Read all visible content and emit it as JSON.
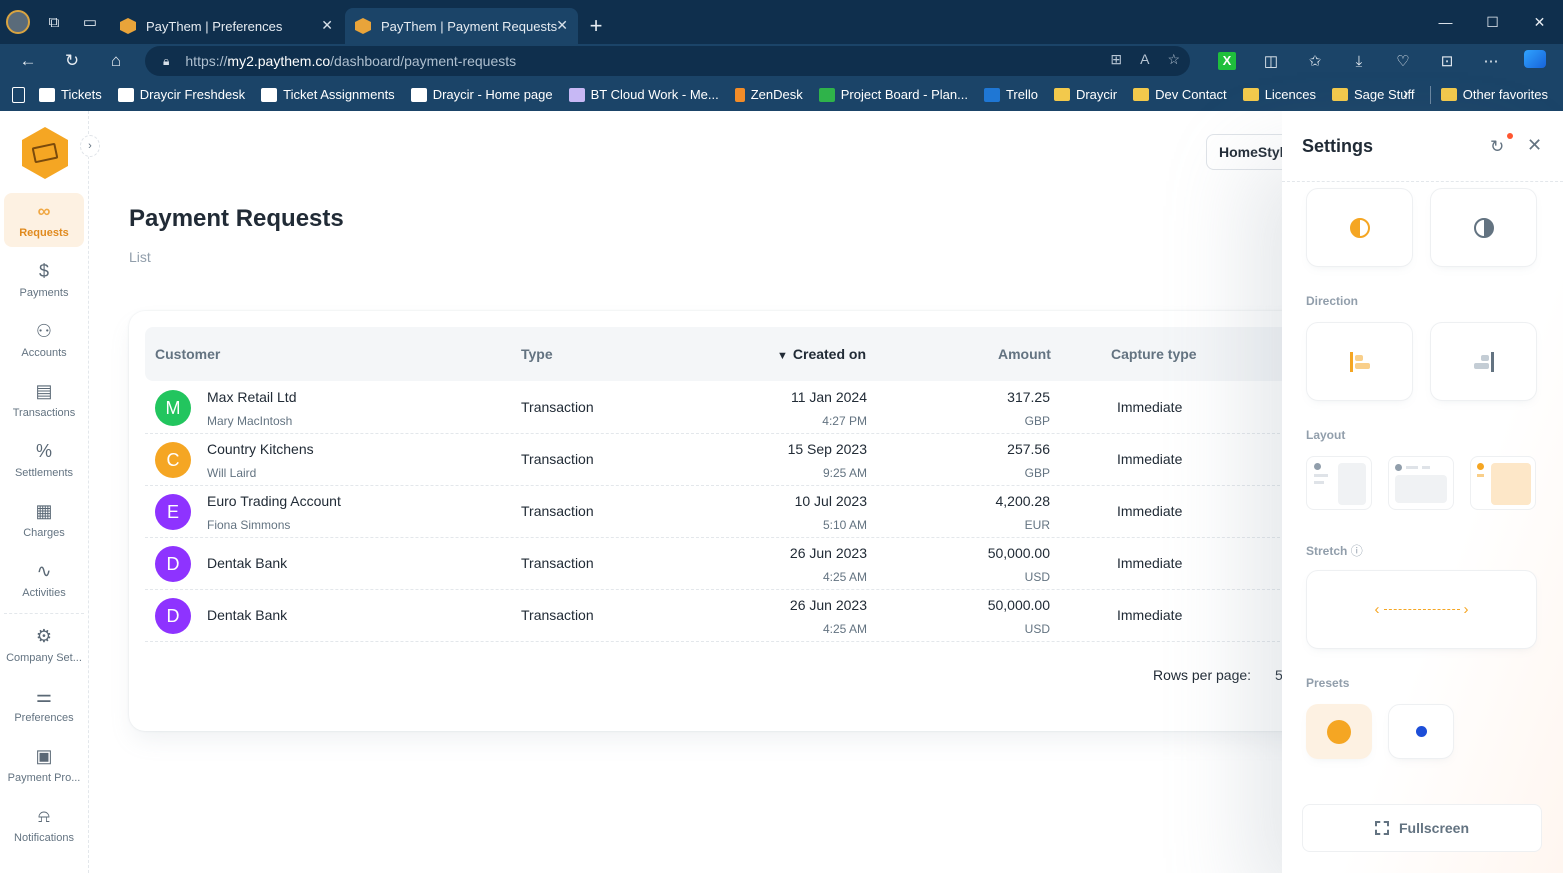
{
  "browser": {
    "tabs": [
      {
        "title": "PayThem | Preferences",
        "active": false
      },
      {
        "title": "PayThem | Payment Requests",
        "active": true
      }
    ],
    "url_prefix": "https://",
    "url_host": "my2.paythem.co",
    "url_path": "/dashboard/payment-requests",
    "bookmarks": [
      {
        "label": "Tickets",
        "icon": "site-icon"
      },
      {
        "label": "Draycir Freshdesk",
        "icon": "site-icon"
      },
      {
        "label": "Ticket Assignments",
        "icon": "site-icon"
      },
      {
        "label": "Draycir - Home page",
        "icon": "site-icon"
      },
      {
        "label": "BT Cloud Work - Me...",
        "icon": "site-icon"
      },
      {
        "label": "ZenDesk",
        "icon": "site-icon"
      },
      {
        "label": "Project Board - Plan...",
        "icon": "site-icon"
      },
      {
        "label": "Trello",
        "icon": "site-icon"
      },
      {
        "label": "Draycir",
        "icon": "folder-icon"
      },
      {
        "label": "Dev Contact",
        "icon": "folder-icon"
      },
      {
        "label": "Licences",
        "icon": "folder-icon"
      },
      {
        "label": "Sage Stuff",
        "icon": "folder-icon"
      }
    ],
    "other_favorites": "Other favorites"
  },
  "sidebar": {
    "items": [
      {
        "label": "Requests",
        "icon": "link-icon",
        "glyph": "⚲",
        "active": true
      },
      {
        "label": "Payments",
        "icon": "piggy-bank-icon",
        "glyph": "$",
        "active": false
      },
      {
        "label": "Accounts",
        "icon": "users-icon",
        "glyph": "⚇",
        "active": false
      },
      {
        "label": "Transactions",
        "icon": "receipt-icon",
        "glyph": "▤",
        "active": false
      },
      {
        "label": "Settlements",
        "icon": "percent-icon",
        "glyph": "%",
        "active": false
      },
      {
        "label": "Charges",
        "icon": "calculator-icon",
        "glyph": "▦",
        "active": false
      },
      {
        "label": "Activities",
        "icon": "activity-icon",
        "glyph": "∿",
        "active": false
      },
      {
        "label": "Company Set...",
        "icon": "gear-icon",
        "glyph": "⚙",
        "active": false
      },
      {
        "label": "Preferences",
        "icon": "sliders-icon",
        "glyph": "⚌",
        "active": false
      },
      {
        "label": "Payment Pro...",
        "icon": "banknote-icon",
        "glyph": "▣",
        "active": false
      },
      {
        "label": "Notifications",
        "icon": "bell-icon",
        "glyph": "♫",
        "active": false
      }
    ]
  },
  "main": {
    "title": "Payment Requests",
    "breadcrumb": "List",
    "store": "HomeStyle",
    "columns": {
      "customer": "Customer",
      "type": "Type",
      "created": "Created on",
      "amount": "Amount",
      "capture": "Capture type"
    },
    "rows": [
      {
        "initial": "M",
        "color": "#22c55e",
        "customer": "Max Retail Ltd",
        "contact": "Mary MacIntosh",
        "type": "Transaction",
        "date": "11 Jan 2024",
        "time": "4:27 PM",
        "amount": "317.25",
        "currency": "GBP",
        "capture": "Immediate"
      },
      {
        "initial": "C",
        "color": "#f5a623",
        "customer": "Country Kitchens",
        "contact": "Will Laird",
        "type": "Transaction",
        "date": "15 Sep 2023",
        "time": "9:25 AM",
        "amount": "257.56",
        "currency": "GBP",
        "capture": "Immediate"
      },
      {
        "initial": "E",
        "color": "#8e33ff",
        "customer": "Euro Trading Account",
        "contact": "Fiona Simmons",
        "type": "Transaction",
        "date": "10 Jul 2023",
        "time": "5:10 AM",
        "amount": "4,200.28",
        "currency": "EUR",
        "capture": "Immediate"
      },
      {
        "initial": "D",
        "color": "#8e33ff",
        "customer": "Dentak Bank",
        "contact": "",
        "type": "Transaction",
        "date": "26 Jun 2023",
        "time": "4:25 AM",
        "amount": "50,000.00",
        "currency": "USD",
        "capture": "Immediate"
      },
      {
        "initial": "D",
        "color": "#8e33ff",
        "customer": "Dentak Bank",
        "contact": "",
        "type": "Transaction",
        "date": "26 Jun 2023",
        "time": "4:25 AM",
        "amount": "50,000.00",
        "currency": "USD",
        "capture": "Immediate"
      }
    ],
    "rows_per_page_label": "Rows per page:",
    "rows_per_page_value": "5"
  },
  "settings": {
    "title": "Settings",
    "direction_label": "Direction",
    "layout_label": "Layout",
    "stretch_label": "Stretch",
    "presets_label": "Presets",
    "fullscreen_label": "Fullscreen",
    "preset_colors": [
      "#f5a623",
      "#1d4ed8"
    ]
  }
}
